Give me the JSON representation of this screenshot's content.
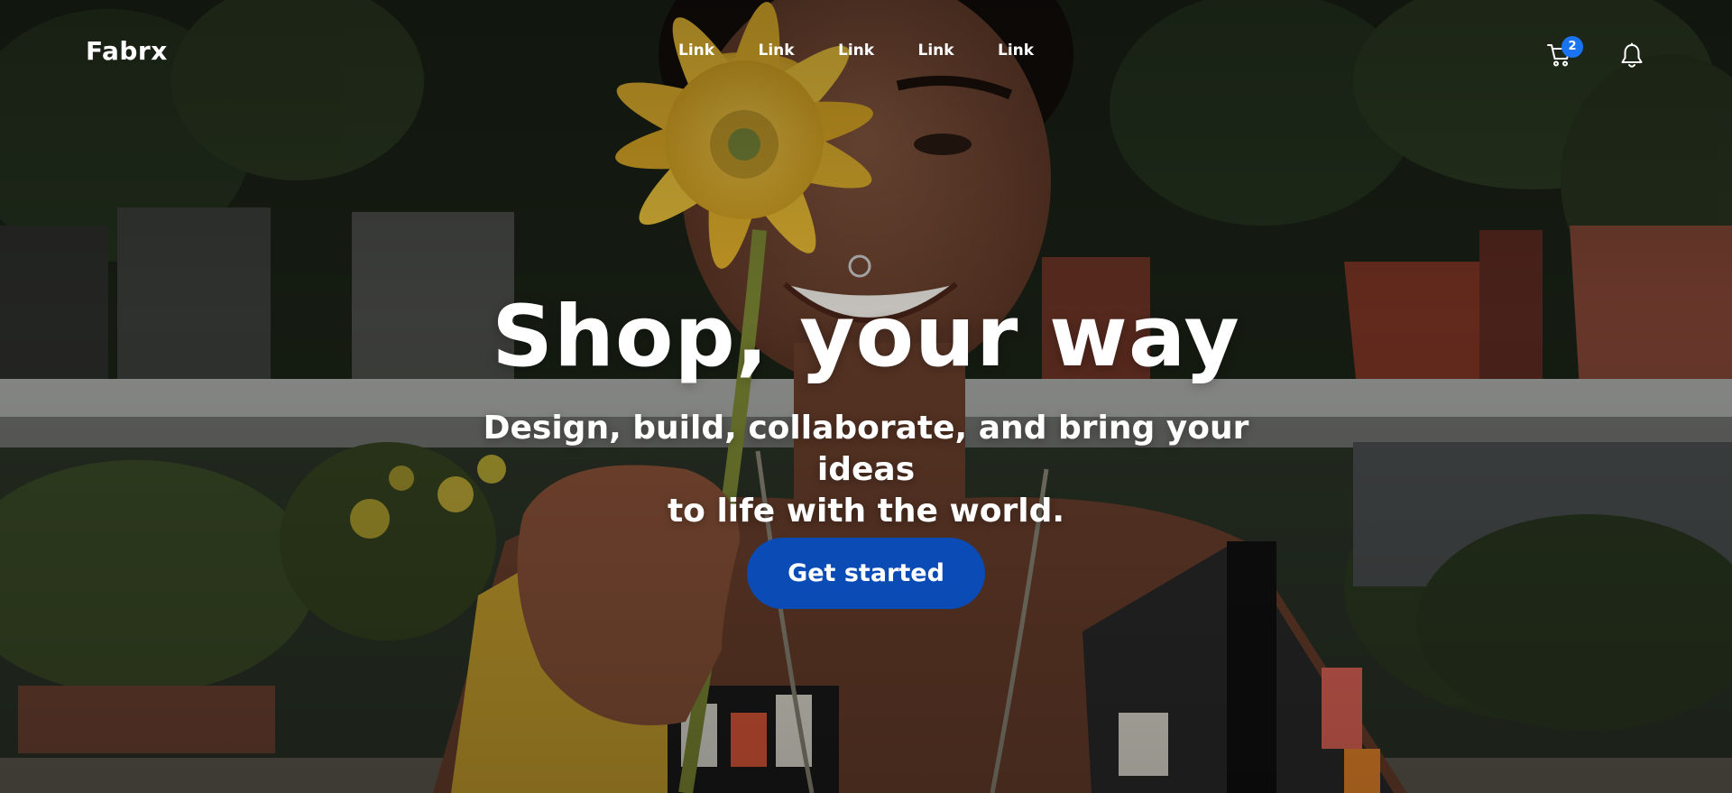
{
  "header": {
    "brand": "Fabrx",
    "nav": [
      {
        "label": "Link"
      },
      {
        "label": "Link"
      },
      {
        "label": "Link"
      },
      {
        "label": "Link"
      },
      {
        "label": "Link"
      }
    ],
    "cart": {
      "icon": "cart-icon",
      "badge_count": "2"
    },
    "notifications": {
      "icon": "bell-icon"
    }
  },
  "hero": {
    "title": "Shop, your way",
    "subtitle_line1": "Design, build, collaborate, and bring your ideas",
    "subtitle_line2": "to life with the world.",
    "cta_label": "Get started",
    "background_image": "woman-holding-yellow-flower-photo"
  },
  "colors": {
    "cta_background": "#0b4bb5",
    "badge_background": "#1a73f0",
    "text": "#ffffff"
  }
}
